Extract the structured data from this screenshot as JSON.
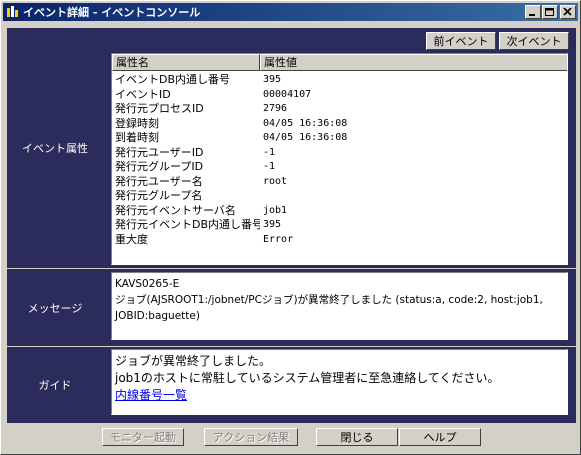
{
  "window": {
    "title": "イベント詳細 - イベントコンソール",
    "controls": {
      "minimize": "minimize-icon",
      "maximize": "maximize-icon",
      "close": "close-icon"
    }
  },
  "attributes_section": {
    "label": "イベント属性",
    "prev_button": "前イベント",
    "next_button": "次イベント",
    "headers": {
      "name": "属性名",
      "value": "属性値"
    },
    "rows": [
      {
        "name": "イベントDB内通し番号",
        "value": "395"
      },
      {
        "name": "イベントID",
        "value": "00004107"
      },
      {
        "name": "発行元プロセスID",
        "value": "2796"
      },
      {
        "name": "登録時刻",
        "value": "04/05 16:36:08"
      },
      {
        "name": "到着時刻",
        "value": "04/05 16:36:08"
      },
      {
        "name": "発行元ユーザーID",
        "value": "-1"
      },
      {
        "name": "発行元グループID",
        "value": "-1"
      },
      {
        "name": "発行元ユーザー名",
        "value": "root"
      },
      {
        "name": "発行元グループ名",
        "value": ""
      },
      {
        "name": "発行元イベントサーバ名",
        "value": "job1"
      },
      {
        "name": "発行元イベントDB内通し番号",
        "value": "395"
      },
      {
        "name": "重大度",
        "value": "Error"
      }
    ]
  },
  "message_section": {
    "label": "メッセージ",
    "lines": [
      "KAVS0265-E",
      "ジョブ(AJSROOT1:/jobnet/PCジョブ)が異常終了しました (status:a, code:2, host:job1,",
      "JOBID:baguette)"
    ]
  },
  "guide_section": {
    "label": "ガイド",
    "line1": "ジョブが異常終了しました。",
    "line2": "job1のホストに常駐しているシステム管理者に至急連絡してください。",
    "link": "内線番号一覧"
  },
  "footer": {
    "monitor_button": "モニター起動",
    "action_button": "アクション結果",
    "close_button": "閉じる",
    "help_button": "ヘルプ"
  },
  "colors": {
    "panel": "#2c2c5c",
    "titlebar_start": "#0a246a",
    "titlebar_end": "#3a6ea5",
    "face": "#d4d0c8"
  }
}
